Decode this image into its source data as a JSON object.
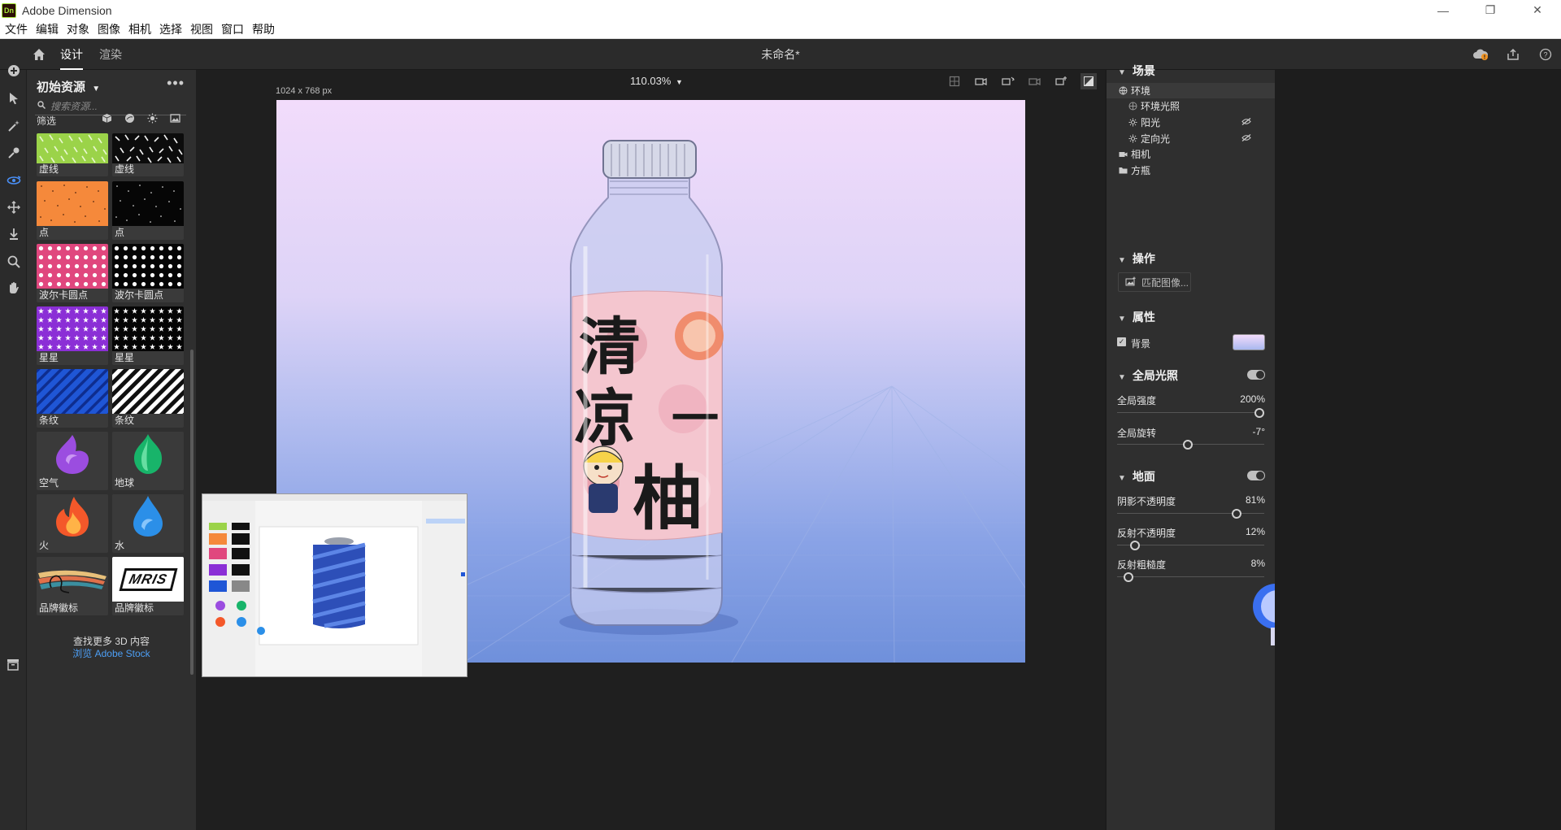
{
  "window": {
    "app_title": "Adobe Dimension",
    "app_icon_text": "Dn",
    "controls": [
      "minimize",
      "restore",
      "close"
    ]
  },
  "menubar": [
    "文件",
    "编辑",
    "对象",
    "图像",
    "相机",
    "选择",
    "视图",
    "窗口",
    "帮助"
  ],
  "header": {
    "tabs": [
      {
        "label": "设计",
        "active": true
      },
      {
        "label": "渲染",
        "active": false
      }
    ],
    "document_title": "未命名*",
    "right_icons": [
      "cloud-sync-icon",
      "share-icon",
      "help-icon"
    ]
  },
  "toolbar": {
    "tools": [
      "add-icon",
      "select-icon",
      "magic-wand-icon",
      "sampler-icon",
      "orbit-icon",
      "pan-icon",
      "dolly-icon",
      "zoom-icon",
      "hand-icon"
    ],
    "active_tool": "orbit-icon"
  },
  "assets": {
    "title": "初始资源",
    "search_placeholder": "搜索资源...",
    "filter_label": "筛选",
    "filter_icons": [
      "model-filter-icon",
      "material-filter-icon",
      "light-filter-icon",
      "image-filter-icon"
    ],
    "items": [
      {
        "label": "虚线",
        "thumb": "dash-green"
      },
      {
        "label": "虚线",
        "thumb": "dash-black"
      },
      {
        "label": "点",
        "thumb": "dots-orange"
      },
      {
        "label": "点",
        "thumb": "dots-black"
      },
      {
        "label": "波尔卡圆点",
        "thumb": "polka-pink"
      },
      {
        "label": "波尔卡圆点",
        "thumb": "polka-black"
      },
      {
        "label": "星星",
        "thumb": "stars-purple"
      },
      {
        "label": "星星",
        "thumb": "stars-black"
      },
      {
        "label": "条纹",
        "thumb": "stripes-blue"
      },
      {
        "label": "条纹",
        "thumb": "stripes-bw"
      },
      {
        "label": "空气",
        "thumb": "air-drop"
      },
      {
        "label": "地球",
        "thumb": "earth-drop"
      },
      {
        "label": "火",
        "thumb": "fire-drop"
      },
      {
        "label": "水",
        "thumb": "water-drop"
      },
      {
        "label": "品牌徽标",
        "thumb": "brand-logo-1"
      },
      {
        "label": "品牌徽标",
        "thumb": "brand-logo-2"
      }
    ],
    "brand_logo_text": "MRIS",
    "more_3d_text": "查找更多 3D 内容",
    "browse_stock_text": "浏览 Adobe Stock"
  },
  "canvas": {
    "zoom": "110.03%",
    "size_label": "1024 x 768 px",
    "view_tools": [
      "frame-icon",
      "camera-view-1-icon",
      "camera-view-2-icon",
      "camera-view-3-icon",
      "camera-view-4-icon",
      "render-preview-icon"
    ],
    "label_chars": [
      "清",
      "凉",
      "一",
      "柚"
    ]
  },
  "scene_panel": {
    "title": "场景",
    "tree": [
      {
        "label": "环境",
        "icon": "globe-icon",
        "level": 0,
        "selected": true
      },
      {
        "label": "环境光照",
        "icon": "environment-light-icon",
        "level": 1
      },
      {
        "label": "阳光",
        "icon": "sun-icon",
        "level": 1,
        "hidden": true
      },
      {
        "label": "定向光",
        "icon": "directional-light-icon",
        "level": 1,
        "hidden": true
      },
      {
        "label": "相机",
        "icon": "camera-icon",
        "level": 0
      },
      {
        "label": "方瓶",
        "icon": "folder-icon",
        "level": 0
      }
    ]
  },
  "actions_panel": {
    "title": "操作",
    "match_image_label": "匹配图像..."
  },
  "properties_panel": {
    "title": "属性",
    "background_label": "背景",
    "background_checked": true,
    "global_lighting": {
      "title": "全局光照",
      "enabled": true,
      "intensity_label": "全局强度",
      "intensity_value": "200%",
      "intensity_fraction": 1.0,
      "rotation_label": "全局旋转",
      "rotation_value": "-7°",
      "rotation_fraction": 0.48
    },
    "ground": {
      "title": "地面",
      "enabled": true,
      "shadow_label": "阴影不透明度",
      "shadow_value": "81%",
      "shadow_fraction": 0.81,
      "reflection_label": "反射不透明度",
      "reflection_value": "12%",
      "reflection_fraction": 0.12,
      "roughness_label": "反射粗糙度",
      "roughness_value": "8%",
      "roughness_fraction": 0.08
    }
  }
}
